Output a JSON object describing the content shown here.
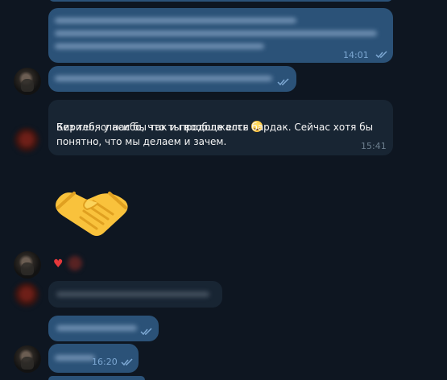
{
  "messages": [
    {
      "id": "m1",
      "direction": "outgoing",
      "time": "14:01",
      "status": "read"
    },
    {
      "id": "m2",
      "direction": "outgoing",
      "status": "read"
    },
    {
      "id": "m3",
      "direction": "incoming",
      "text_line1": "Кирилл, спасибо, что ты вообще есть",
      "text_line2": "Без тебя у нас бы так и продолжался бардак. Сейчас хотя бы\nпонятно, что мы делаем и зачем.",
      "emoji": "smiling-face-with-smiling-eyes",
      "time": "15:41"
    },
    {
      "id": "m4",
      "direction": "outgoing",
      "sticker": "handshake"
    },
    {
      "id": "m5",
      "direction": "outgoing",
      "reaction": "heart"
    },
    {
      "id": "m6",
      "direction": "incoming"
    },
    {
      "id": "m7",
      "direction": "outgoing",
      "status": "read"
    },
    {
      "id": "m8",
      "direction": "outgoing",
      "time": "16:20",
      "status": "read"
    }
  ],
  "colors": {
    "background": "#0e1621",
    "outgoing_bubble": "#2b5278",
    "incoming_bubble": "#182533",
    "read_check": "#7da8d3"
  }
}
